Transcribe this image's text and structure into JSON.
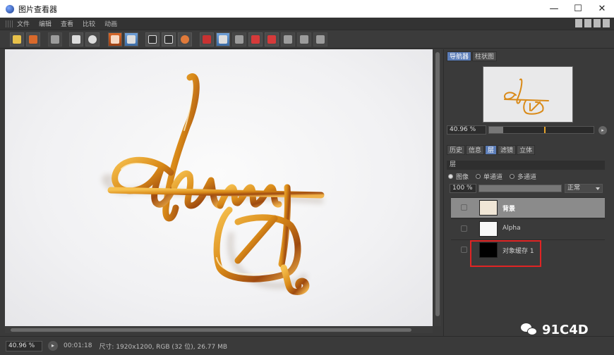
{
  "window": {
    "title": "图片查看器",
    "minimize": "—",
    "maximize": "☐",
    "close": "✕"
  },
  "menu": [
    "文件",
    "编辑",
    "查看",
    "比较",
    "动画"
  ],
  "navigator": {
    "tabs": [
      "导航器",
      "柱状图"
    ],
    "active_tab": 0,
    "zoom": "40.96 %",
    "zoom_level": 0.0
  },
  "layers_panel": {
    "tabs": [
      "历史",
      "信息",
      "层",
      "滤镜",
      "立体"
    ],
    "active_tab": 2,
    "section_title": "层",
    "modes": [
      "图像",
      "单通道",
      "多通道"
    ],
    "selected_mode": 0,
    "opacity": "100 %",
    "blend_mode": "正常",
    "layers": [
      {
        "name": "背景",
        "selected": true
      },
      {
        "name": "Alpha",
        "selected": false
      },
      {
        "name": "对象缓存 1",
        "selected": false
      }
    ]
  },
  "statusbar": {
    "zoom": "40.96 %",
    "play_icon": "▸",
    "time": "00:01:18",
    "info": "尺寸: 1920x1200, RGB (32 位), 26.77 MB"
  },
  "watermark": "91C4D",
  "accent_colors": {
    "highlight": "#e02424",
    "active_tab": "#5b7db8",
    "gold": "#d98a18"
  }
}
